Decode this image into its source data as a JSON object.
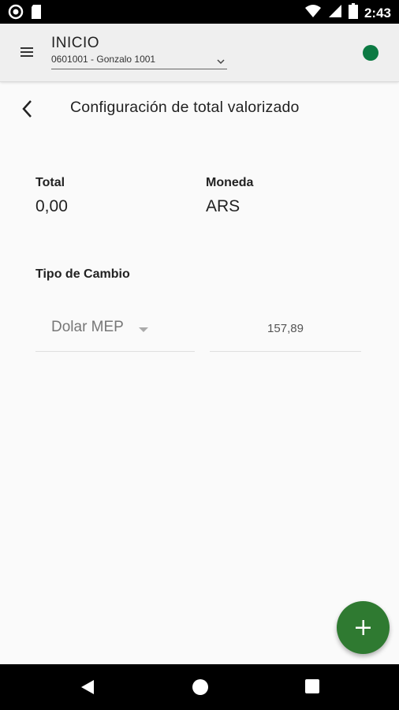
{
  "status_bar": {
    "time": "2:43",
    "icons": [
      "notification-circle-icon",
      "sim-card-icon",
      "wifi-icon",
      "signal-icon",
      "battery-icon"
    ]
  },
  "app_bar": {
    "title": "INICIO",
    "account_selector": {
      "value": "0601001 - Gonzalo 1001"
    },
    "status_dot_color": "#0c7a43"
  },
  "page": {
    "title": "Configuración de total valorizado"
  },
  "summary": {
    "total_label": "Total",
    "total_value": "0,00",
    "currency_label": "Moneda",
    "currency_value": "ARS"
  },
  "exchange": {
    "label": "Tipo de Cambio",
    "type_selected": "Dolar MEP",
    "rate_value": "157,89"
  },
  "fab": {
    "icon": "plus-icon",
    "color": "#2f7a31"
  },
  "nav_bar": {
    "icons": [
      "back-triangle-icon",
      "home-circle-icon",
      "recents-square-icon"
    ]
  }
}
